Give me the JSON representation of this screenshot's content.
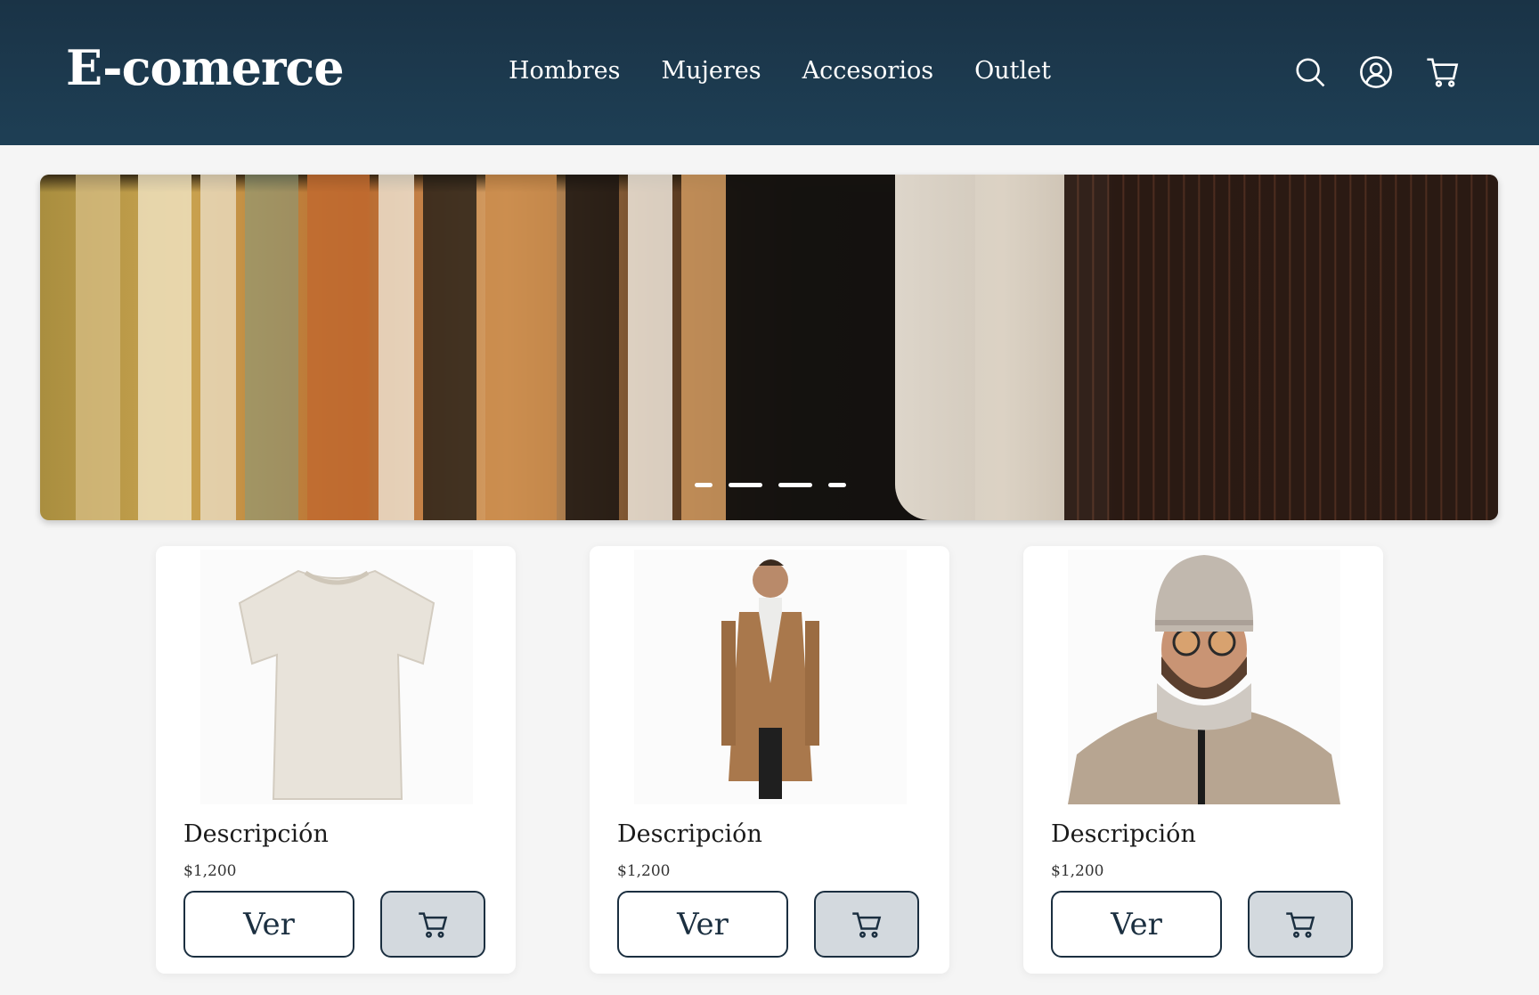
{
  "header": {
    "logo": "E-comerce",
    "nav": [
      "Hombres",
      "Mujeres",
      "Accesorios",
      "Outlet"
    ],
    "icons": [
      "search-icon",
      "user-icon",
      "cart-icon"
    ],
    "background": "#1e3a4f"
  },
  "hero": {
    "slide_count": 4,
    "active_slide": 2
  },
  "products": [
    {
      "title": "Descripción",
      "price": "$1,200",
      "view_label": "Ver",
      "image": "white t-shirt"
    },
    {
      "title": "Descripción",
      "price": "$1,200",
      "view_label": "Ver",
      "image": "man in camel coat"
    },
    {
      "title": "Descripción",
      "price": "$1,200",
      "view_label": "Ver",
      "image": "man in beanie and scarf"
    }
  ],
  "colors": {
    "primary": "#1b2f40",
    "cart_button_bg": "#d3d9de",
    "page_bg": "#f5f5f5"
  }
}
